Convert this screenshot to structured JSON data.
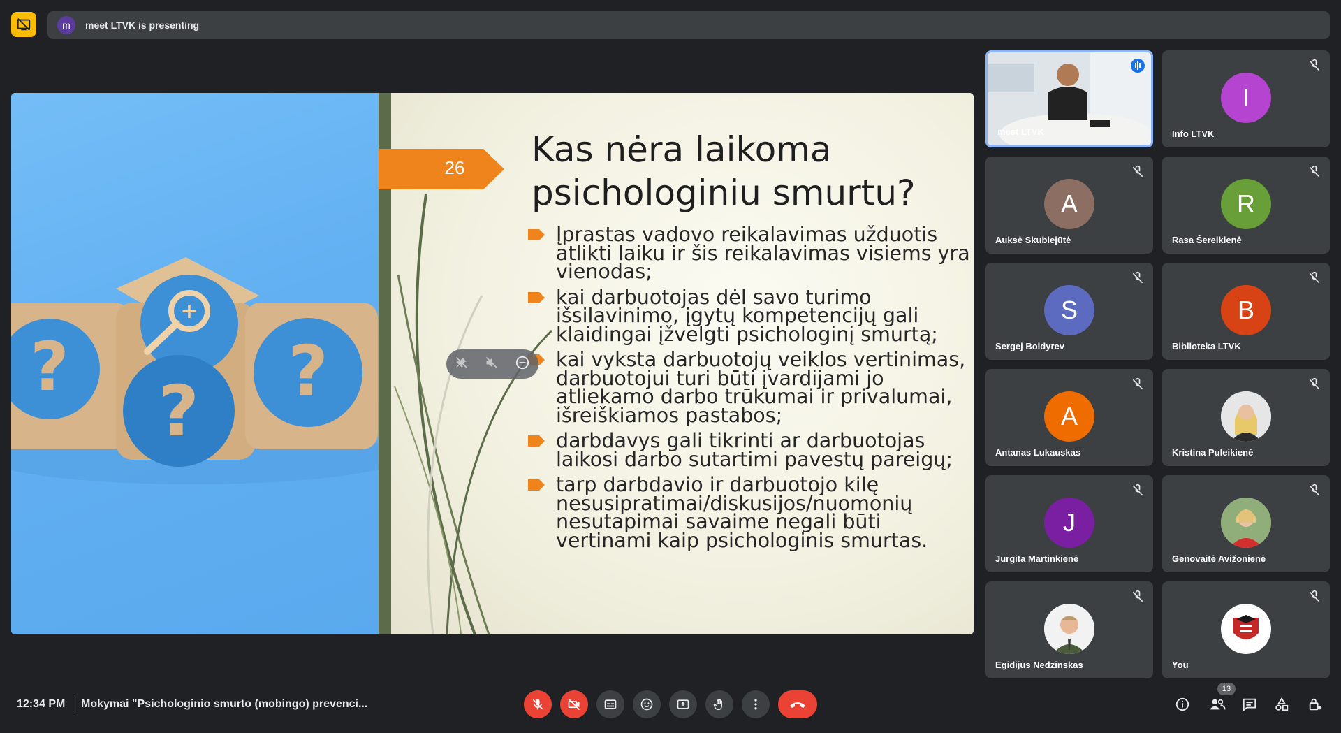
{
  "banner": {
    "avatar_letter": "m",
    "text": "meet LTVK is presenting"
  },
  "slide": {
    "number": "26",
    "title_line1": "Kas nėra laikoma",
    "title_line2": "psichologiniu smurtu?",
    "bullets": [
      "Įprastas vadovo reikalavimas užduotis atlikti laiku ir šis reikalavimas visiems yra vienodas;",
      "kai darbuotojas dėl savo turimo išsilavinimo, įgytų kompetencijų gali klaidingai įžvelgti psichologinį smurtą;",
      "kai vyksta darbuotojų veiklos vertinimas, darbuotojui turi būti įvardijami jo atliekamo darbo trūkumai ir privalumai, išreiškiamos pastabos;",
      "darbdavys gali tikrinti ar darbuotojas laikosi darbo sutartimi pavestų pareigų;",
      "tarp darbdavio ir darbuotojo kilę nesusipratimai/diskusijos/nuomonių nesutapimai savaime negali būti vertinami kaip psichologinis smurtas."
    ],
    "accent_color": "#f0841c"
  },
  "participants": [
    {
      "name": "meet LTVK",
      "letter": "",
      "color": "#3c4043",
      "speaking": true
    },
    {
      "name": "Info LTVK",
      "letter": "I",
      "color": "#b545d1"
    },
    {
      "name": "Auksė Skubiejūtė",
      "letter": "A",
      "color": "#8d6e63"
    },
    {
      "name": "Rasa Šereikienė",
      "letter": "R",
      "color": "#689f38"
    },
    {
      "name": "Sergej Boldyrev",
      "letter": "S",
      "color": "#5c6bc0"
    },
    {
      "name": "Biblioteka LTVK",
      "letter": "B",
      "color": "#d84315"
    },
    {
      "name": "Antanas Lukauskas",
      "letter": "A",
      "color": "#ef6c00"
    },
    {
      "name": "Kristina Puleikienė",
      "letter": "",
      "color": "#d7d7d7"
    },
    {
      "name": "Jurgita Martinkienė",
      "letter": "J",
      "color": "#7b1fa2"
    },
    {
      "name": "Genovaitė Avižonienė",
      "letter": "",
      "color": "#c9c9c9"
    },
    {
      "name": "Egidijus Nedzinskas",
      "letter": "",
      "color": "#e0e0e0"
    },
    {
      "name": "You",
      "letter": "",
      "color": "#ffffff"
    }
  ],
  "bottom": {
    "time": "12:34 PM",
    "meeting_title": "Mokymai \"Psichologinio smurto (mobingo) prevenci...",
    "participant_count": "13"
  },
  "colors": {
    "mic_off_red": "#ea4335",
    "bar_bg": "#3c4043",
    "page_bg": "#202124"
  }
}
